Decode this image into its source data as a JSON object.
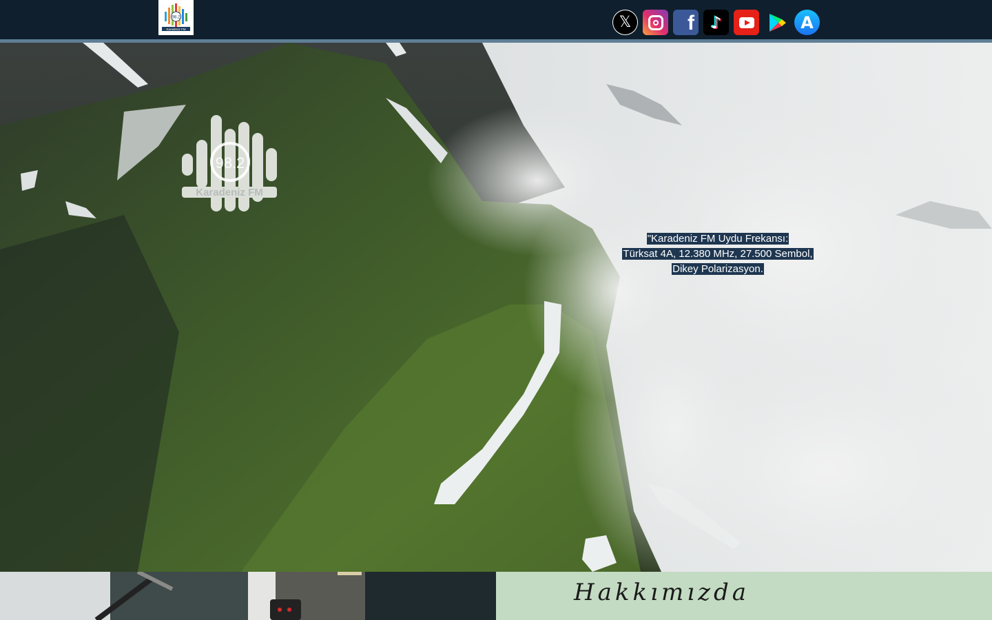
{
  "header": {
    "logo": {
      "name": "karadeniz-fm-logo",
      "text_top": "98.2",
      "text_bottom": "Karadeniz FM"
    },
    "socials": [
      {
        "name": "x-icon",
        "glyph": "𝕏"
      },
      {
        "name": "instagram-icon",
        "glyph": ""
      },
      {
        "name": "facebook-icon",
        "glyph": "f"
      },
      {
        "name": "tiktok-icon",
        "glyph": "♪"
      },
      {
        "name": "youtube-icon",
        "glyph": ""
      },
      {
        "name": "google-play-icon",
        "glyph": ""
      },
      {
        "name": "app-store-icon",
        "glyph": "A"
      }
    ]
  },
  "hero": {
    "logo_frequency": "98.2",
    "logo_name": "Karadeniz FM",
    "frequency_lines": [
      "\"Karadeniz FM Uydu Frekansı:",
      "Türksat 4A, 12.380 MHz, 27.500 Sembol,",
      "Dikey Polarizasyon."
    ]
  },
  "about": {
    "title": "Hakkımızda"
  },
  "colors": {
    "header_bg": "#0f1f2e",
    "header_border": "#5f7f96",
    "about_bg": "#c3dbc2",
    "text_highlight": "#1e3650"
  }
}
